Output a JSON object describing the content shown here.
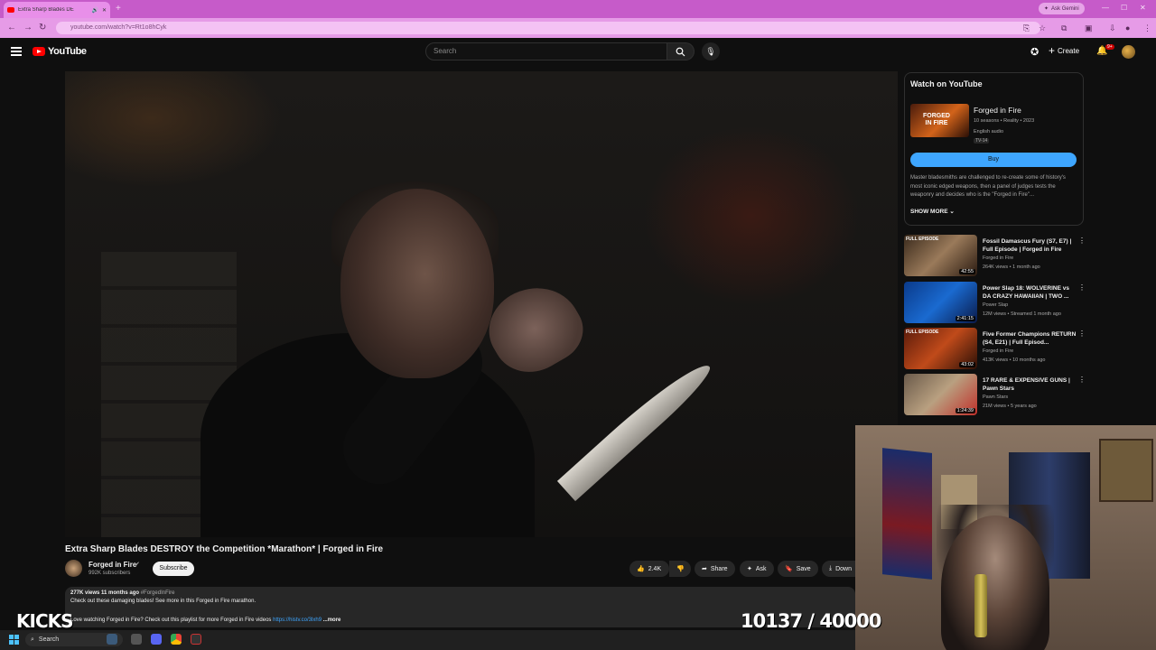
{
  "browser": {
    "tab_title": "Extra Sharp Blades DE",
    "url": "youtube.com/watch?v=Rt1o8hCyk",
    "ask_gemini": "Ask Gemini"
  },
  "header": {
    "logo_text": "YouTube",
    "search_placeholder": "Search",
    "create_label": "Create",
    "notifications_badge": "9+"
  },
  "video": {
    "title": "Extra Sharp Blades DESTROY the Competition *Marathon* | Forged in Fire",
    "channel": "Forged in Fire",
    "subscribers": "992K subscribers",
    "subscribe_label": "Subscribe",
    "likes": "2.4K",
    "share_label": "Share",
    "ask_label": "Ask",
    "save_label": "Save",
    "download_label": "Down",
    "views": "277K views",
    "age": "11 months ago",
    "hashtag": "#ForgedInFire",
    "desc_line1": "Check out these damaging blades! See more in this Forged in Fire marathon.",
    "desc_line2_prefix": "Love watching Forged in Fire? Check out this playlist for more Forged in Fire videos",
    "desc_link": "https://histv.co/3lxh9",
    "more_label": "...more"
  },
  "watch_panel": {
    "heading": "Watch on YouTube",
    "show_title": "Forged in Fire",
    "show_meta": "10 seasons • Reality • 2023",
    "show_audio": "English audio",
    "show_rating": "TV-14",
    "buy_label": "Buy",
    "description": "Master bladesmiths are challenged to re-create some of history's most iconic edged weapons, then a panel of judges tests the weaponry and decides who is the \"Forged in Fire\"...",
    "show_more_label": "SHOW MORE"
  },
  "recommendations": [
    {
      "title": "Fossil Damascus Fury (S7, E7) | Full Episode | Forged in Fire",
      "channel": "Forged in Fire",
      "stats": "264K views • 1 month ago",
      "duration": "42:55",
      "tag": "FULL EPISODE"
    },
    {
      "title": "Power Slap 18: WOLVERINE vs DA CRAZY HAWAIIAN | TWO ...",
      "channel": "Power Slap",
      "stats": "12M views • Streamed 1 month ago",
      "duration": "2:41:15",
      "tag": ""
    },
    {
      "title": "Five Former Champions RETURN (S4, E21) | Full Episod...",
      "channel": "Forged in Fire",
      "stats": "413K views • 10 months ago",
      "duration": "43:02",
      "tag": "FULL EPISODE"
    },
    {
      "title": "17 RARE & EXPENSIVE GUNS | Pawn Stars",
      "channel": "Pawn Stars",
      "stats": "21M views • 5 years ago",
      "duration": "1:24:39",
      "tag": ""
    }
  ],
  "overlay": {
    "logo_text": "KICKS",
    "counter": "10137 / 40000"
  },
  "taskbar": {
    "search_label": "Search"
  },
  "colors": {
    "browser_accent": "#c65bc9",
    "youtube_red": "#ff0000",
    "buy_blue": "#3ea6ff",
    "background": "#0f0f0f"
  }
}
